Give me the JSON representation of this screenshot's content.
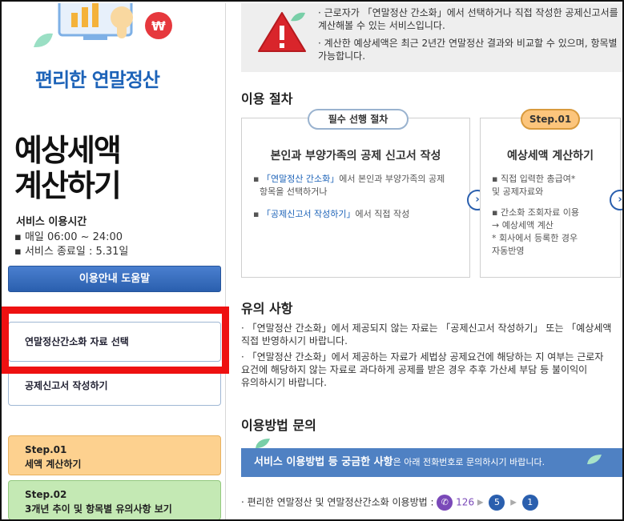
{
  "sidebar": {
    "brand": "편리한 연말정산",
    "title_line1": "예상세액",
    "title_line2": "계산하기",
    "service_time_label": "서비스 이용시간",
    "service_hours": "▪ 매일 06:00 ~ 24:00",
    "service_end": "▪ 서비스 종료일 : 5.31일",
    "help_button": "이용안내 도움말",
    "nav_items": [
      {
        "label": "연말정산간소화 자료 선택"
      },
      {
        "label": "공제신고서 작성하기"
      }
    ],
    "steps": [
      {
        "step": "Step.01",
        "label": "세액 계산하기"
      },
      {
        "step": "Step.02",
        "label": "3개년 추이 및 항목별 유의사항 보기"
      }
    ],
    "colors": {
      "highlight_box": "#ee1111",
      "step1_bg": "#fdd18f",
      "step2_bg": "#c4e9b4"
    }
  },
  "notice": {
    "line1a": "· 근로자가 「연말정산 간소화」에서 선택하거나 직접 작성한 공제신고서를",
    "line1b": "  계산해볼 수 있는 서비스입니다.",
    "line2a": "· 계산한 예상세액은 최근 2년간 연말정산 결과와 비교할 수 있으며, 항목별",
    "line2b": "  가능합니다."
  },
  "procedure": {
    "section_title": "이용 절차",
    "card1": {
      "pill": "필수 선행 절차",
      "heading": "본인과 부양가족의 공제 신고서 작성",
      "item1_link": "「연말정산 간소화」",
      "item1_rest": "에서 본인과 부양가족의 공제",
      "item1_line2": "항목을 선택하거나",
      "item2_link": "「공제신고서 작성하기」",
      "item2_rest": "에서 직접 작성"
    },
    "card2": {
      "pill": "Step.01",
      "heading": "예상세액 계산하기",
      "line1": "▪ 직접 입력한 총급여*",
      "line2": "  및 공제자료와",
      "line3": "▪ 간소화 조회자료 이용",
      "line4": "  → 예상세액 계산",
      "line5": "  * 회사에서 등록한 경우",
      "line6": "    자동반영"
    },
    "next_arrow": "›"
  },
  "caution": {
    "section_title": "유의 사항",
    "p1a": "· 「연말정산 간소화」에서 제공되지 않는 자료는 「공제신고서 작성하기」 또는 「예상세액",
    "p1b": "  직접 반영하시기 바랍니다.",
    "p2a": "· 「연말정산 간소화」에서 제공하는 자료가 세법상 공제요건에 해당하는 지 여부는 근로자",
    "p2b": "  요건에 해당하지 않는 자료로 과다하게 공제를 받은 경우 추후 가산세 부담 등 불이익이",
    "p2c": "  유의하시기 바랍니다."
  },
  "inquiry": {
    "section_title": "이용방법 문의",
    "banner_bold": "서비스 이용방법 등 궁금한 사항",
    "banner_rest": "은 아래 전화번호로 문의하시기 바랍니다.",
    "contact_label": "· 편리한 연말정산 및 연말정산간소화 이용방법 :",
    "phone": "126",
    "menu1": "5",
    "menu2": "1"
  }
}
